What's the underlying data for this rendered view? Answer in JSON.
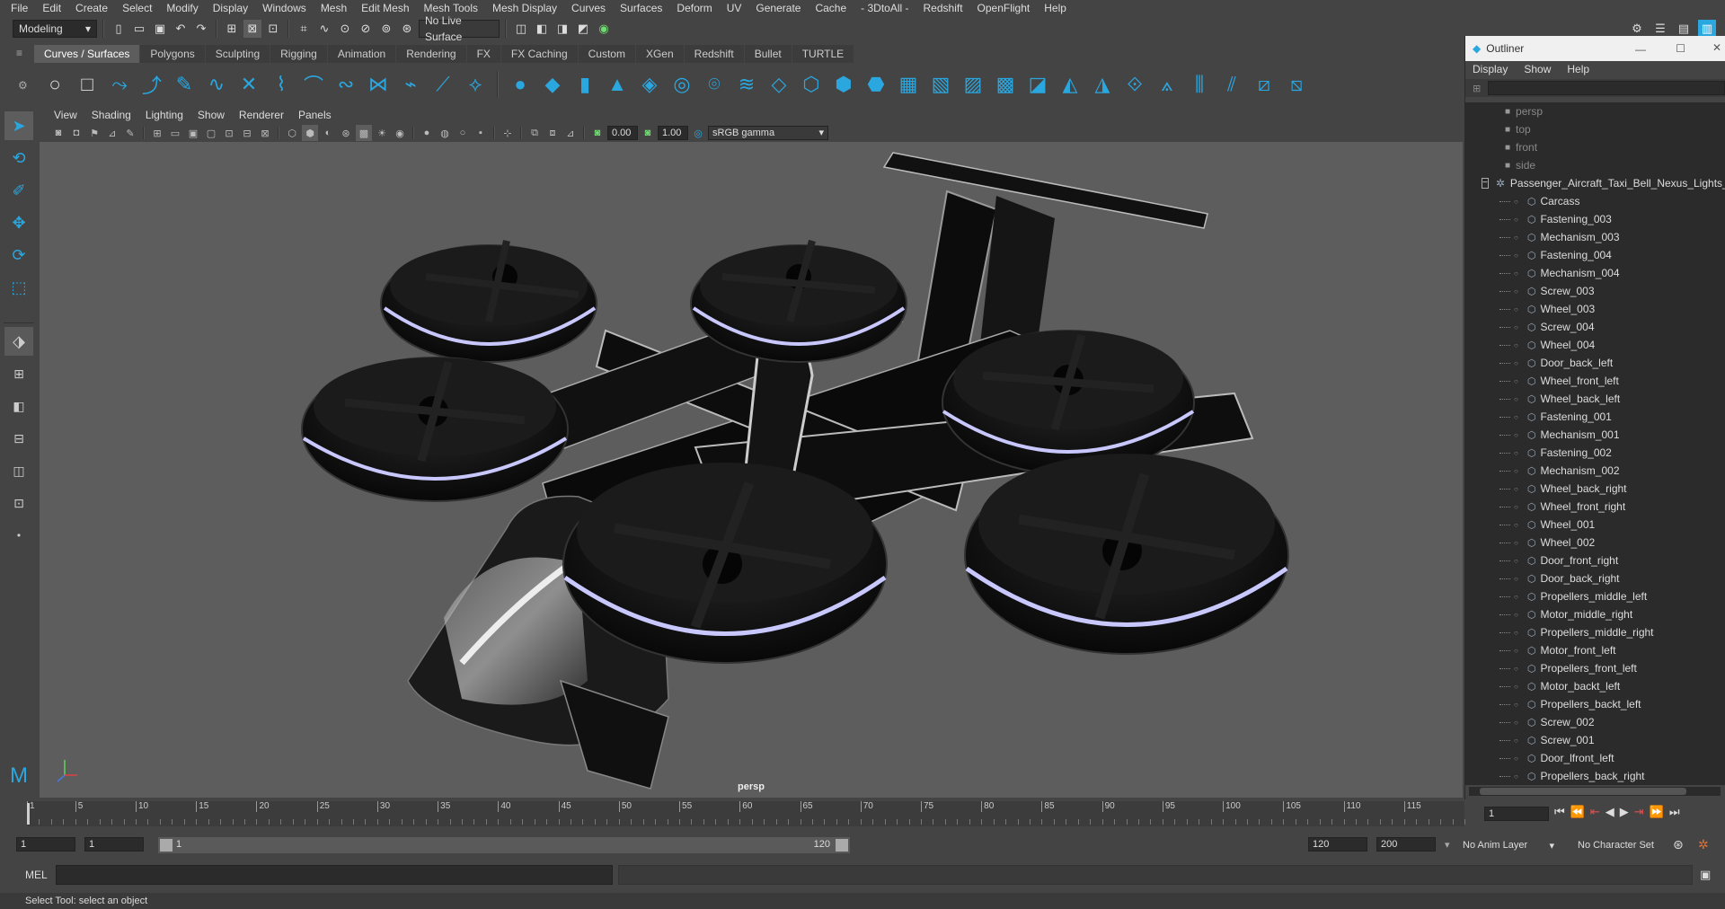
{
  "menubar": [
    "File",
    "Edit",
    "Create",
    "Select",
    "Modify",
    "Display",
    "Windows",
    "Mesh",
    "Edit Mesh",
    "Mesh Tools",
    "Mesh Display",
    "Curves",
    "Surfaces",
    "Deform",
    "UV",
    "Generate",
    "Cache",
    "- 3DtoAll -",
    "Redshift",
    "OpenFlight",
    "Help"
  ],
  "status": {
    "workspace": "Modeling",
    "live_surface": "No Live Surface"
  },
  "shelf_tabs": [
    "Curves / Surfaces",
    "Polygons",
    "Sculpting",
    "Rigging",
    "Animation",
    "Rendering",
    "FX",
    "FX Caching",
    "Custom",
    "XGen",
    "Redshift",
    "Bullet",
    "TURTLE"
  ],
  "panel_menu": [
    "View",
    "Shading",
    "Lighting",
    "Show",
    "Renderer",
    "Panels"
  ],
  "panel_tools": {
    "exposure": "0.00",
    "gamma": "1.00",
    "colorspace": "sRGB gamma"
  },
  "viewport": {
    "camera_label": "persp"
  },
  "outliner": {
    "title": "Outliner",
    "menu": [
      "Display",
      "Show",
      "Help"
    ],
    "cameras": [
      "persp",
      "top",
      "front",
      "side"
    ],
    "root": "Passenger_Aircraft_Taxi_Bell_Nexus_Lights_O",
    "children": [
      "Carcass",
      "Fastening_003",
      "Mechanism_003",
      "Fastening_004",
      "Mechanism_004",
      "Screw_003",
      "Wheel_003",
      "Screw_004",
      "Wheel_004",
      "Door_back_left",
      "Wheel_front_left",
      "Wheel_back_left",
      "Fastening_001",
      "Mechanism_001",
      "Fastening_002",
      "Mechanism_002",
      "Wheel_back_right",
      "Wheel_front_right",
      "Wheel_001",
      "Wheel_002",
      "Door_front_right",
      "Door_back_right",
      "Propellers_middle_left",
      "Motor_middle_right",
      "Propellers_middle_right",
      "Motor_front_left",
      "Propellers_front_left",
      "Motor_backt_left",
      "Propellers_backt_left",
      "Screw_002",
      "Screw_001",
      "Door_lfront_left",
      "Propellers_back_right"
    ]
  },
  "timeline": {
    "ticks": [
      "1",
      "5",
      "10",
      "15",
      "20",
      "25",
      "30",
      "35",
      "40",
      "45",
      "50",
      "55",
      "60",
      "65",
      "70",
      "75",
      "80",
      "85",
      "90",
      "95",
      "100",
      "105",
      "110",
      "115"
    ],
    "current_frame": "1"
  },
  "range": {
    "start": "1",
    "inner_start": "1",
    "slider_start": "1",
    "slider_end": "120",
    "end": "120",
    "anim_end": "200",
    "anim_layer": "No Anim Layer",
    "character_set": "No Character Set"
  },
  "cmdline": {
    "lang": "MEL"
  },
  "helpline": {
    "text": "Select Tool: select an object"
  }
}
